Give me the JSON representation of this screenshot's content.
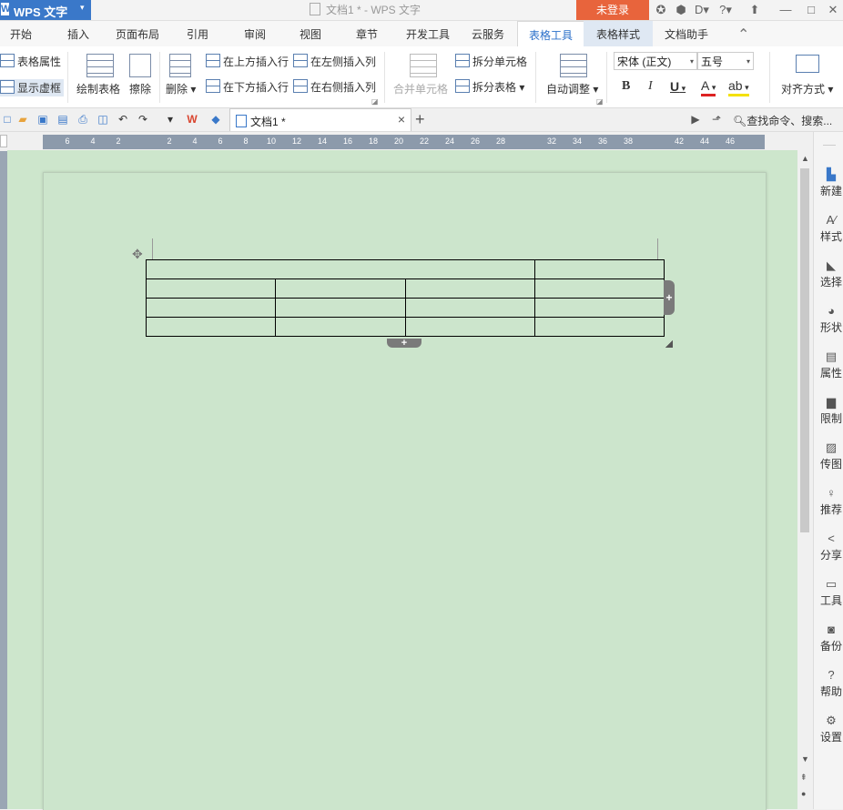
{
  "app": {
    "name": "WPS 文字",
    "window_title": "文档1 * - WPS 文字",
    "login": "未登录"
  },
  "titlebar": {
    "icons": [
      "skin-icon",
      "settings-icon",
      "feedback-icon",
      "help-icon",
      "restore-icon",
      "minimize-icon",
      "maximize-icon"
    ],
    "help": "?"
  },
  "tabs": [
    "开始",
    "插入",
    "页面布局",
    "引用",
    "审阅",
    "视图",
    "章节",
    "开发工具",
    "云服务",
    "表格工具",
    "表格样式",
    "文档助手"
  ],
  "active_tab": "表格工具",
  "ribbon": {
    "table_props": "表格属性",
    "show_grid": "显示虚框",
    "draw_table": "绘制表格",
    "erase": "擦除",
    "delete": "删除",
    "insert_above": "在上方插入行",
    "insert_below": "在下方插入行",
    "insert_left": "在左侧插入列",
    "insert_right": "在右侧插入列",
    "merge_cells": "合并单元格",
    "split_cells": "拆分单元格",
    "split_table": "拆分表格",
    "auto_fit": "自动调整",
    "font_name": "宋体 (正文)",
    "font_size": "五号",
    "bold": "B",
    "italic": "I",
    "underline": "U",
    "font_color": "A",
    "align": "对齐方式"
  },
  "doc_tab": {
    "name": "文档1 *",
    "close": "×",
    "new": "+"
  },
  "search": {
    "placeholder": "查找命令、搜索..."
  },
  "ruler": {
    "ticks": [
      "6",
      "4",
      "2",
      "2",
      "4",
      "6",
      "8",
      "10",
      "12",
      "14",
      "16",
      "18",
      "20",
      "22",
      "24",
      "26",
      "28",
      "32",
      "34",
      "36",
      "38",
      "42",
      "44",
      "46"
    ]
  },
  "table": {
    "rows": 4,
    "cols": 4,
    "first_row_merged": true
  },
  "sidebar": [
    {
      "label": "新建",
      "icon": "new-doc-icon"
    },
    {
      "label": "样式",
      "icon": "style-icon"
    },
    {
      "label": "选择",
      "icon": "select-icon"
    },
    {
      "label": "形状",
      "icon": "shape-icon"
    },
    {
      "label": "属性",
      "icon": "properties-icon"
    },
    {
      "label": "限制",
      "icon": "restrict-icon"
    },
    {
      "label": "传图",
      "icon": "image-upload-icon"
    },
    {
      "label": "推荐",
      "icon": "recommend-icon"
    },
    {
      "label": "分享",
      "icon": "share-icon"
    },
    {
      "label": "工具",
      "icon": "toolbox-icon"
    },
    {
      "label": "备份",
      "icon": "backup-icon"
    },
    {
      "label": "帮助",
      "icon": "help-icon"
    },
    {
      "label": "设置",
      "icon": "gear-icon"
    }
  ]
}
